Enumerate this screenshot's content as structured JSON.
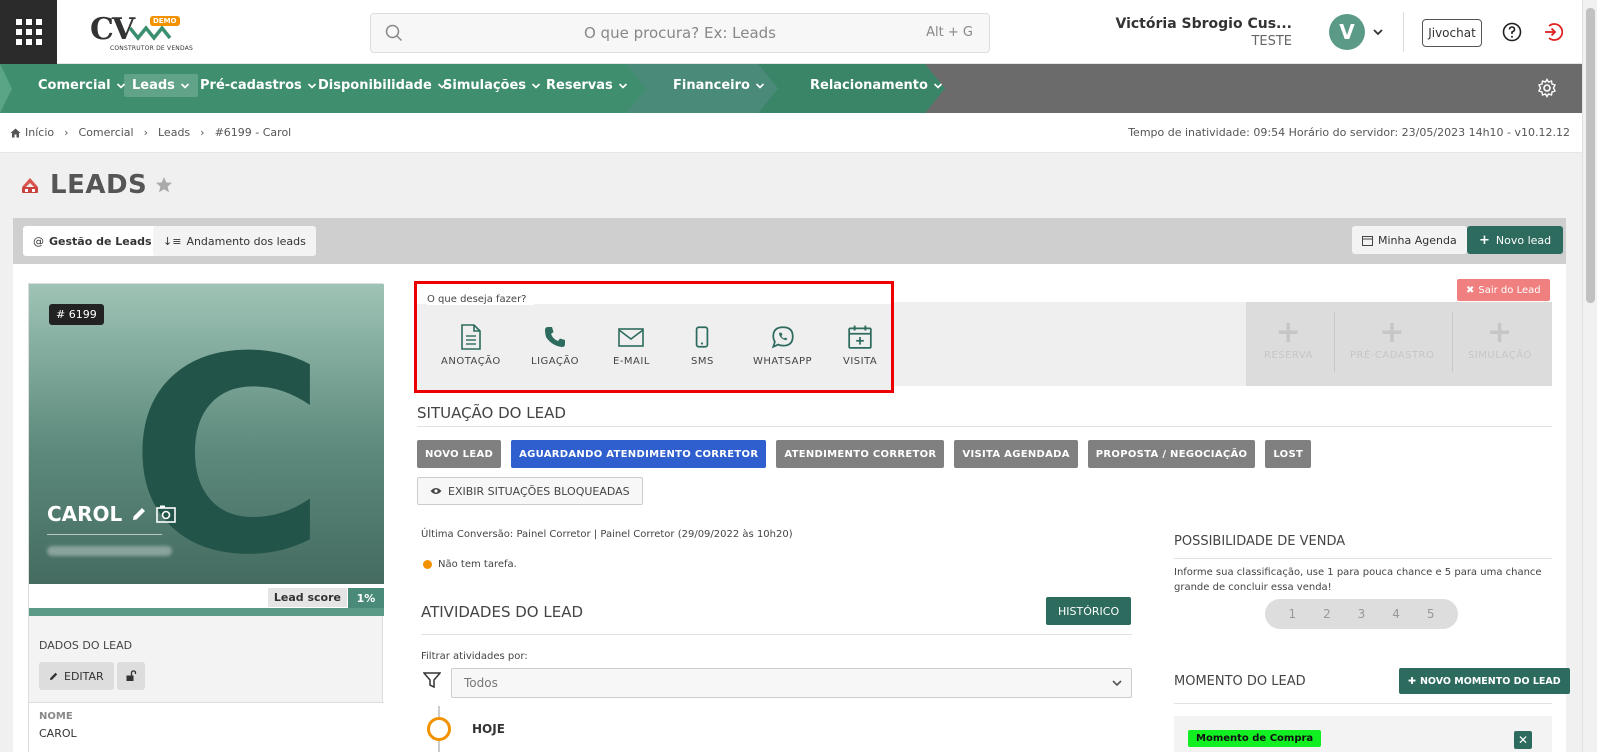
{
  "header": {
    "logo_text": "CV",
    "logo_badge": "DEMO",
    "logo_subtitle": "CONSTRUTOR DE VENDAS",
    "search_placeholder": "O que procura? Ex: Leads",
    "search_shortcut": "Alt + G",
    "user_name": "Victória Sbrogio Cus...",
    "user_org": "TESTE",
    "avatar_letter": "V",
    "jivochat_label": "Jivochat"
  },
  "nav": {
    "items": [
      "Comercial",
      "Leads",
      "Pré-cadastros",
      "Disponibilidade",
      "Simulações",
      "Reservas",
      "Financeiro",
      "Relacionamento"
    ],
    "active": "Leads",
    "colors": {
      "comercial": "#3f8f6f",
      "financeiro": "#4a8a78",
      "relacionamento": "#3a8467",
      "bar": "#6b6b6b"
    }
  },
  "breadcrumb": {
    "items": [
      "Início",
      "Comercial",
      "Leads",
      "#6199 - Carol"
    ],
    "status": "Tempo de inatividade: 09:54   Horário do servidor: 23/05/2023 14h10 - v10.12.12"
  },
  "page": {
    "title": "LEADS"
  },
  "tabs": {
    "gestao": "Gestão de Leads",
    "andamento": "Andamento dos leads",
    "agenda": "Minha Agenda",
    "novo_lead": "Novo lead"
  },
  "lead": {
    "id_badge": "# 6199",
    "initial": "C",
    "name": "CAROL",
    "score_label": "Lead score",
    "score_value": "1%",
    "dados_title": "DADOS DO LEAD",
    "edit_label": "EDITAR",
    "field_label": "NOME",
    "field_value": "CAROL"
  },
  "actions": {
    "prompt": "O que deseja fazer?",
    "items": [
      "ANOTAÇÃO",
      "LIGAÇÃO",
      "E-MAIL",
      "SMS",
      "WHATSAPP",
      "VISITA"
    ],
    "disabled_items": [
      "RESERVA",
      "PRÉ-CADASTRO",
      "SIMULAÇÃO"
    ],
    "exit_label": "Sair do Lead"
  },
  "situacao": {
    "title": "SITUAÇÃO DO LEAD",
    "statuses": [
      "NOVO LEAD",
      "AGUARDANDO ATENDIMENTO CORRETOR",
      "ATENDIMENTO CORRETOR",
      "VISITA AGENDADA",
      "PROPOSTA / NEGOCIAÇÃO",
      "LOST"
    ],
    "current": "AGUARDANDO ATENDIMENTO CORRETOR",
    "show_blocked": "EXIBIR SITUAÇÕES BLOQUEADAS"
  },
  "info": {
    "last_conversion": "Última Conversão: Painel Corretor | Painel Corretor (29/09/2022 às 10h20)",
    "task": "Não tem tarefa."
  },
  "atividades": {
    "title": "ATIVIDADES DO LEAD",
    "historico_label": "HISTÓRICO",
    "filter_label": "Filtrar atividades por:",
    "filter_value": "Todos",
    "today_label": "HOJE"
  },
  "possibilidade": {
    "title": "POSSIBILIDADE DE VENDA",
    "text": "Informe sua classificação, use 1 para pouca chance e 5 para uma chance grande de concluir essa venda!",
    "ratings": [
      "1",
      "2",
      "3",
      "4",
      "5"
    ]
  },
  "momento": {
    "title": "MOMENTO DO LEAD",
    "new_label": "NOVO MOMENTO DO LEAD",
    "badge": "Momento de Compra"
  }
}
